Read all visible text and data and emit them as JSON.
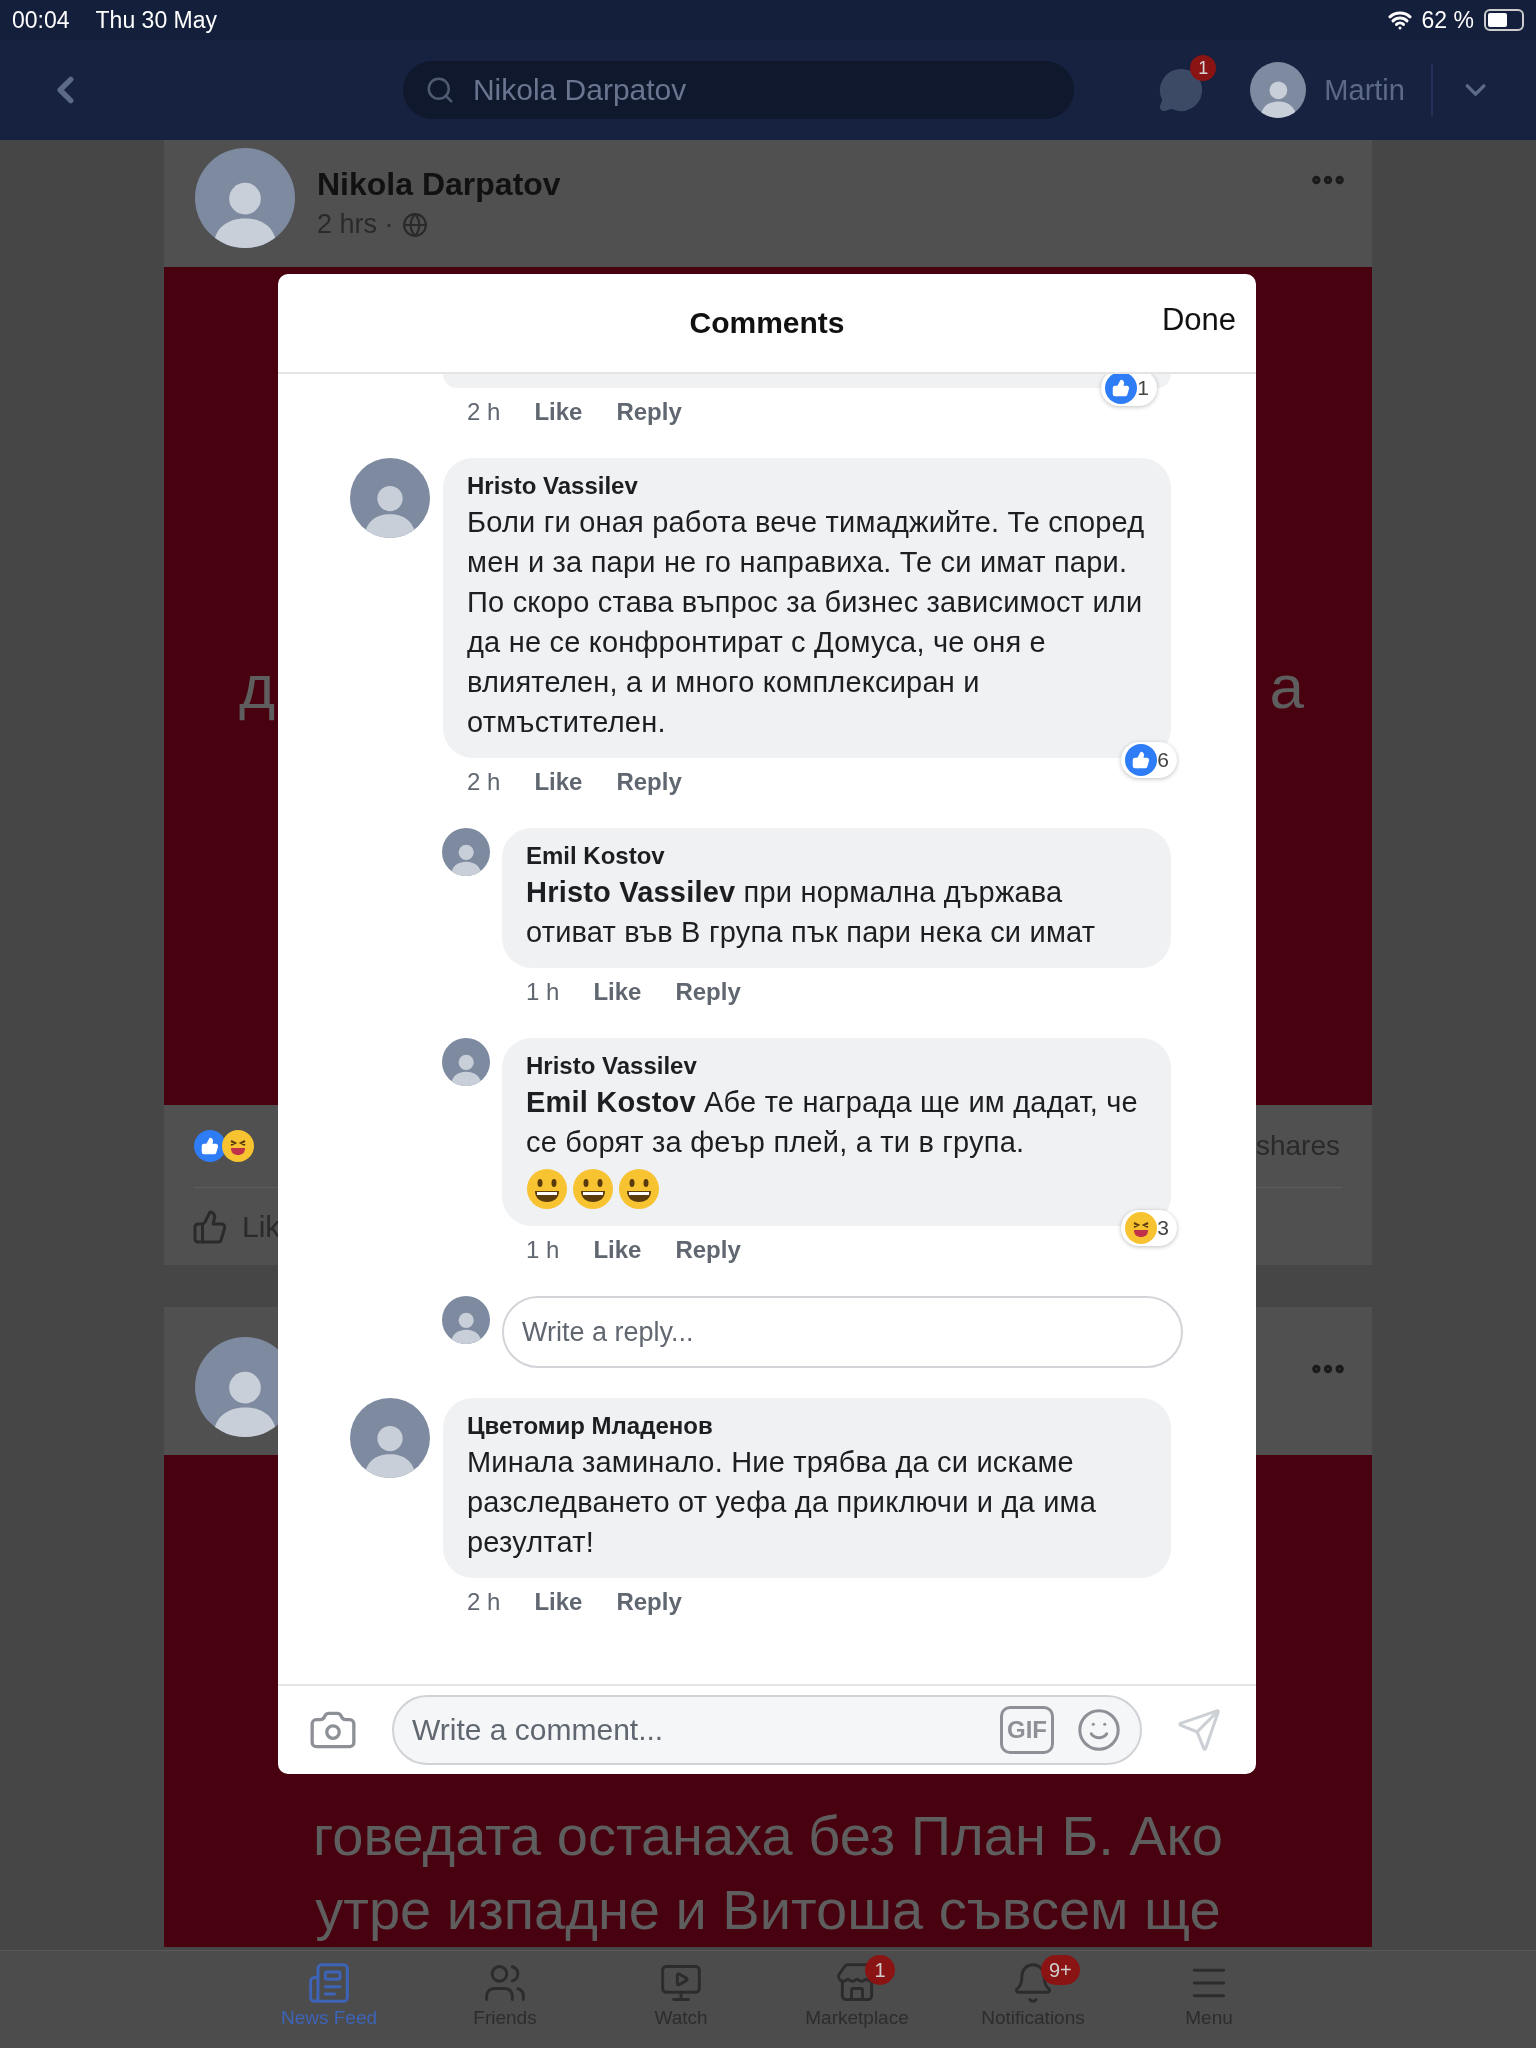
{
  "status_bar": {
    "time": "00:04",
    "date": "Thu 30 May",
    "battery": "62 %"
  },
  "nav": {
    "search": "Nikola Darpatov",
    "messenger_badge": "1",
    "user": "Martin"
  },
  "post_top": {
    "author": "Nikola Darpatov",
    "time": "2 hrs ·",
    "text_left": "д",
    "text_right": "а",
    "shares": "shares",
    "like": "Lik"
  },
  "post_bottom": {
    "text_lines": [
      "говедата останаха без План Б. Ако",
      "утре изпадне и Витоша съвсем ще"
    ]
  },
  "comments_dialog": {
    "title": "Comments",
    "done": "Done",
    "comments": [
      {
        "kind": "tail",
        "time": "2 h",
        "like": "Like",
        "reply": "Reply",
        "reaction": {
          "kind": "like",
          "count": "1"
        }
      },
      {
        "kind": "comment",
        "author": "Hristo Vassilev",
        "text": "Боли ги оная работа вече тимаджийте. Те според мен и за пари не го направиха. Те си имат пари. По скоро става въпрос за бизнес зависимост или да не се конфронтират с Домуса, че оня е влиятелен, а и много комплексиран и отмъстителен.",
        "time": "2 h",
        "like": "Like",
        "reply": "Reply",
        "reaction": {
          "kind": "like",
          "count": "6"
        },
        "children": [
          {
            "kind": "comment",
            "author": "Emil Kostov",
            "text": "**Hristo Vassilev** при нормална държава отиват във В група  пък пари нека си имат",
            "time": "1 h",
            "like": "Like",
            "reply": "Reply"
          },
          {
            "kind": "comment",
            "author": "Hristo Vassilev",
            "text": "**Emil Kostov** Абе те награда ще им дадат, че се борят за феър плей, а ти в група.",
            "emojis": [
              {
                "kind": "grin"
              },
              {
                "kind": "grin"
              },
              {
                "kind": "grin"
              }
            ],
            "time": "1 h",
            "like": "Like",
            "reply": "Reply",
            "reaction": {
              "kind": "haha",
              "count": "3"
            }
          },
          {
            "kind": "reply_box",
            "placeholder": "Write a reply..."
          }
        ]
      },
      {
        "kind": "comment",
        "author": "Цветомир Младенов",
        "text": "Минала заминало. Ние трябва да си искаме разследването от уефа да приключи и да има резултат!",
        "time": "2 h",
        "like": "Like",
        "reply": "Reply"
      }
    ],
    "composer": {
      "placeholder": "Write a comment...",
      "gif": "GIF"
    }
  },
  "tab_bar": {
    "items": [
      {
        "label": "News Feed",
        "selected": true
      },
      {
        "label": "Friends",
        "selected": false
      },
      {
        "label": "Watch",
        "selected": false
      },
      {
        "label": "Marketplace",
        "selected": false,
        "badge": "1"
      },
      {
        "label": "Notifications",
        "selected": false,
        "badge": "9+"
      },
      {
        "label": "Menu",
        "selected": false
      }
    ]
  }
}
